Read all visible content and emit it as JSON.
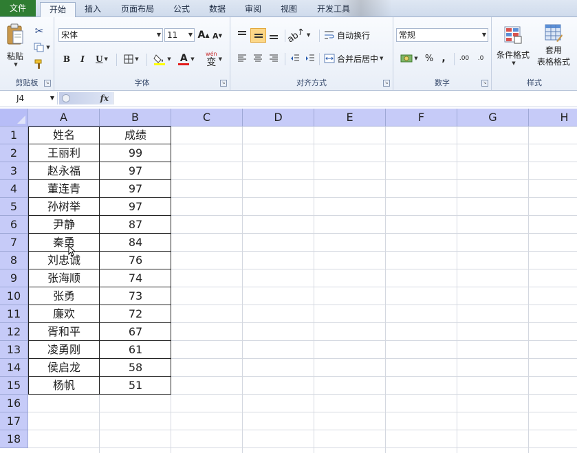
{
  "tabs": {
    "file": "文件",
    "home": "开始",
    "insert": "插入",
    "layout": "页面布局",
    "formulas": "公式",
    "data": "数据",
    "review": "审阅",
    "view": "视图",
    "developer": "开发工具"
  },
  "clipboard": {
    "paste_label": "粘贴",
    "group_label": "剪贴板"
  },
  "font": {
    "font_name": "宋体",
    "font_size": "11",
    "bold": "B",
    "italic": "I",
    "underline": "U",
    "font_color_glyph": "A",
    "phonetic_glyph": "wén",
    "phonetic_char": "变",
    "group_label": "字体",
    "grow_glyph": "A",
    "shrink_glyph": "A"
  },
  "alignment": {
    "wrap_text": "自动换行",
    "merge_center": "合并后居中",
    "group_label": "对齐方式"
  },
  "number": {
    "format": "常规",
    "percent": "%",
    "comma": ",",
    "increase_decimal": ".00",
    "decrease_decimal": ".0",
    "group_label": "数字"
  },
  "styles": {
    "conditional_format": "条件格式",
    "format_as_table_line1": "套用",
    "format_as_table_line2": "表格格式",
    "group_label": "样式"
  },
  "formula_bar": {
    "name_box": "J4",
    "fx": "fx",
    "content": ""
  },
  "columns": [
    "A",
    "B",
    "C",
    "D",
    "E",
    "F",
    "G",
    "H"
  ],
  "rows": [
    "1",
    "2",
    "3",
    "4",
    "5",
    "6",
    "7",
    "8",
    "9",
    "10",
    "11",
    "12",
    "13",
    "14",
    "15",
    "16",
    "17",
    "18"
  ],
  "sheet": {
    "header": [
      "姓名",
      "成绩"
    ],
    "records": [
      [
        "王丽利",
        "99"
      ],
      [
        "赵永福",
        "97"
      ],
      [
        "董连青",
        "97"
      ],
      [
        "孙树举",
        "97"
      ],
      [
        "尹静",
        "87"
      ],
      [
        "秦勇",
        "84"
      ],
      [
        "刘忠诚",
        "76"
      ],
      [
        "张海顺",
        "74"
      ],
      [
        "张勇",
        "73"
      ],
      [
        "廉欢",
        "72"
      ],
      [
        "胥和平",
        "67"
      ],
      [
        "凌勇刚",
        "61"
      ],
      [
        "侯启龙",
        "58"
      ],
      [
        "杨帆",
        "51"
      ]
    ]
  },
  "colors": {
    "file_tab": "#2f7d32",
    "header_fill": "#c6cbf8",
    "selected_button": "#fcd787",
    "font_color_bar": "#e31c1c",
    "fill_color_bar": "#ffff00"
  }
}
